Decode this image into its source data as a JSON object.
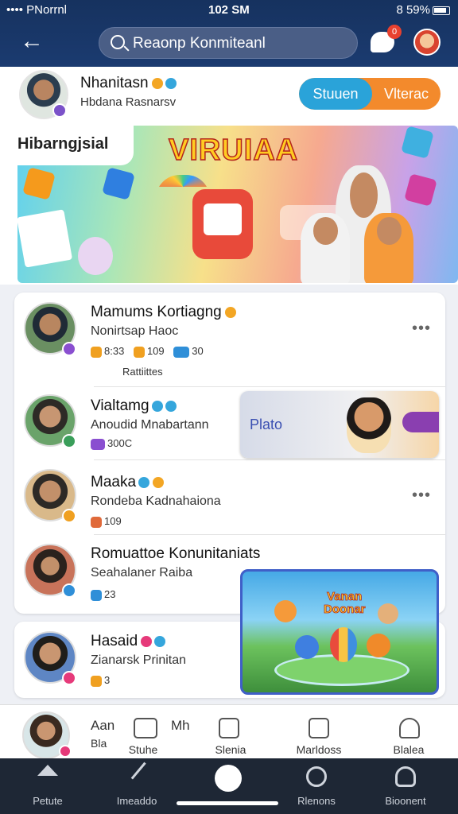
{
  "status_bar": {
    "carrier": "•••• PNorrnl",
    "time": "102 SM",
    "battery": "8 59%"
  },
  "header": {
    "search_placeholder": "Reaonp Konmiteanl",
    "notification_count": "0"
  },
  "profile": {
    "name": "Nhanitasn",
    "subtitle": "Hbdana Rasnarsv",
    "toggle": {
      "left": "Stuuen",
      "right": "Vlterac"
    }
  },
  "banner": {
    "tag": "Hibarngjsial",
    "title": "VIRUIAA"
  },
  "feed": [
    {
      "name": "Mamums Kortiagng",
      "subtitle": "Nonirtsap Haoc",
      "meta": [
        "8:33",
        "109",
        "30"
      ],
      "footnote": "Rattiittes",
      "badge_color": "#8a4fd0"
    },
    {
      "name": "Vialtamg",
      "subtitle": "Anoudid Mnabartann",
      "meta": [
        "300C"
      ],
      "badge_color": "#3a9e5a"
    },
    {
      "name": "Maaka",
      "subtitle": "Rondeba Kadnahaiona",
      "meta": [
        "109"
      ],
      "badge_color": "#f0a020"
    },
    {
      "name": "Romuattoe Konunitaniats",
      "subtitle": "Seahalaner Raiba",
      "meta": [
        "23"
      ],
      "badge_color": "#2f8fd8"
    },
    {
      "name": "Hasaid",
      "subtitle": "Zianarsk Prinitan",
      "meta": [
        "3"
      ],
      "badge_color": "#e63a7a"
    }
  ],
  "promo": {
    "label": "Plato"
  },
  "game_card": {
    "title_line1": "Vanan",
    "title_line2": "Doonar"
  },
  "sub_tabs": {
    "user": {
      "name": "Aan",
      "sub": "Bla"
    },
    "items": [
      {
        "label": "Stuhe",
        "top": "Mh",
        "icon": "photos-icon"
      },
      {
        "label": "Slenia",
        "icon": "camera-icon"
      },
      {
        "label": "Marldoss",
        "icon": "dice-icon"
      },
      {
        "label": "Blalea",
        "icon": "person-icon"
      }
    ]
  },
  "nav": {
    "items": [
      {
        "label": "Petute",
        "icon": "home-icon"
      },
      {
        "label": "Imeaddo",
        "icon": "wand-icon"
      },
      {
        "label": "Rlenons",
        "icon": "search-icon"
      },
      {
        "label": "Bioonent",
        "icon": "person-icon"
      }
    ]
  },
  "colors": {
    "header_bg": "#1b3b70",
    "accent_blue": "#2aa3d9",
    "accent_orange": "#f38a2c",
    "nav_bg": "#1e2735"
  }
}
